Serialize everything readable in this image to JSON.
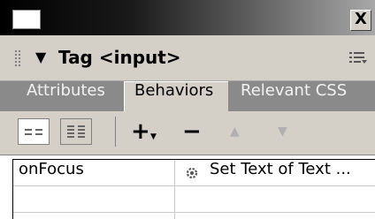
{
  "panel": {
    "title": "Tag <input>"
  },
  "window": {
    "close_glyph": "X"
  },
  "tabs": [
    {
      "label": "Attributes",
      "active": false
    },
    {
      "label": "Behaviors",
      "active": true
    },
    {
      "label": "Relevant CSS",
      "active": false
    }
  ],
  "toolbar": {
    "add_glyph": "+",
    "remove_glyph": "−",
    "up_glyph": "▲",
    "down_glyph": "▼"
  },
  "behaviors": [
    {
      "event": "onFocus",
      "action": "Set Text of Text ..."
    },
    {
      "event": "",
      "action": ""
    }
  ],
  "colors": {
    "title_gradient_start": "#000000",
    "panel_bg": "#d4d0c8",
    "tab_strip_bg": "#8a8a8a"
  }
}
